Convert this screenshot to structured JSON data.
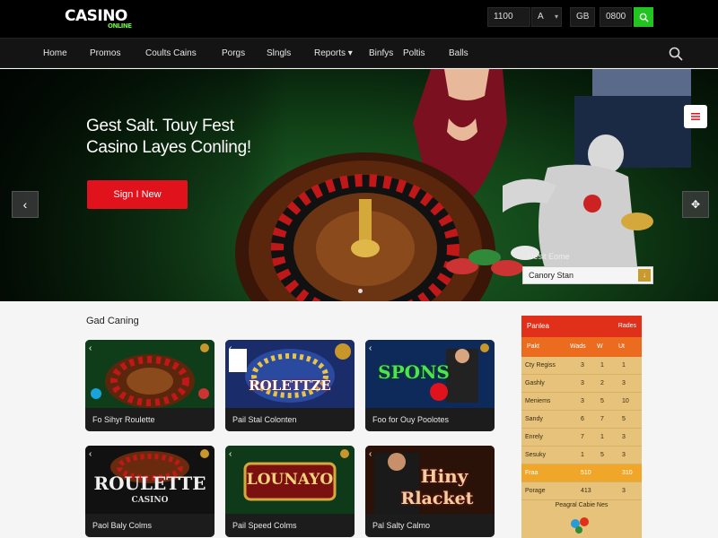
{
  "brand": {
    "logo": "CASINO",
    "logo_sub": "ONLINE",
    "logo_accent": "#6cf03a"
  },
  "topbar": {
    "balance": "1100",
    "currency": "A",
    "currency2": "GB",
    "amount": "0800",
    "go_color": "#21c421"
  },
  "nav": {
    "items": [
      "Home",
      "Promos",
      "Coults Cains",
      "Porgs",
      "Slngls",
      "Reports ▾",
      "Binfys",
      "Poltis",
      "Balls"
    ]
  },
  "hero": {
    "title_line1": "Gest Salt. Touy Fest",
    "title_line2": "Casino Layes Conling!",
    "cta": "Sign I New",
    "form_label": "Uesit Eome",
    "form_value": "Canory Stan",
    "accent": "#e0121b"
  },
  "games_section": {
    "title": "Gad Caning",
    "cards": [
      {
        "label": "Fo Sihyr Roulette",
        "art_text": ""
      },
      {
        "label": "Pail Stal Colonten",
        "art_text": "ROLETTZE"
      },
      {
        "label": "Foo for Ouy Poolotes",
        "art_text": "SPONS"
      },
      {
        "label": "Paol Baly Colms",
        "art_text": "ROULETTE",
        "art_sub": "CASINO"
      },
      {
        "label": "Pail Speed Colms",
        "art_text": "LOUNAYO"
      },
      {
        "label": "Pal Salty Calmo",
        "art_text": "Hiny",
        "art_sub": "Rlacket"
      }
    ]
  },
  "leaderboard": {
    "title": "Panlea",
    "title_right": "Rades",
    "columns": [
      "Pakt",
      "Wads",
      "W",
      "Ut"
    ],
    "rows": [
      {
        "name": "Cty Regiss",
        "v1": "3",
        "v2": "1",
        "v3": "1"
      },
      {
        "name": "Gashly",
        "v1": "3",
        "v2": "2",
        "v3": "3"
      },
      {
        "name": "Meniems",
        "v1": "3",
        "v2": "5",
        "v3": "10"
      },
      {
        "name": "Sandy",
        "v1": "6",
        "v2": "7",
        "v3": "5"
      },
      {
        "name": "Enrely",
        "v1": "7",
        "v2": "1",
        "v3": "3"
      },
      {
        "name": "Sesuky",
        "v1": "1",
        "v2": "5",
        "v3": "3"
      },
      {
        "name": "Fraa",
        "v1": "510",
        "v2": "",
        "v3": "310"
      },
      {
        "name": "Porage",
        "v1": "413",
        "v2": "",
        "v3": "3"
      }
    ],
    "footer": "Peagral Cabie Nes",
    "header_color": "#e0301a",
    "cols_color": "#eb6b1f",
    "highlight_color": "#f0a628"
  }
}
